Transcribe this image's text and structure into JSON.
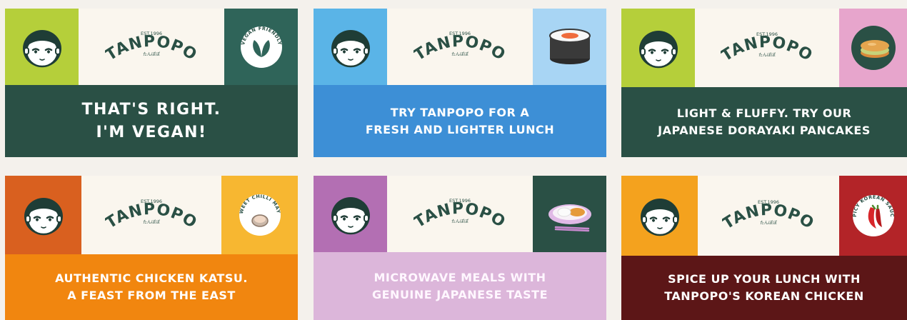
{
  "brand": {
    "name": "TANPOPO",
    "est": "EST.1996",
    "sub": "たんぽぽ"
  },
  "cards": [
    {
      "left_color": "#b5cf3a",
      "right_color": "#2f6459",
      "bottom_color": "#2a5045",
      "text_color": "#ffffff",
      "product_icon": "vegan-leaf-badge-icon",
      "badge_text": "VEGAN FRIENDLY",
      "lines": [
        "THAT'S RIGHT.",
        "I'M VEGAN!"
      ]
    },
    {
      "left_color": "#5ab4e7",
      "right_color": "#a8d5f4",
      "bottom_color": "#3d8fd6",
      "text_color": "#ffffff",
      "product_icon": "sushi-roll-icon",
      "badge_text": "",
      "lines": [
        "TRY TANPOPO FOR A",
        "FRESH AND LIGHTER LUNCH"
      ]
    },
    {
      "left_color": "#b5cf3a",
      "right_color": "#e7a5cc",
      "bottom_color": "#2a5045",
      "text_color": "#ffffff",
      "product_icon": "dorayaki-pancake-icon",
      "badge_text": "",
      "lines": [
        "LIGHT & FLUFFY. TRY OUR",
        "JAPANESE DORAYAKI PANCAKES"
      ]
    },
    {
      "left_color": "#d9601f",
      "right_color": "#f7b731",
      "bottom_color": "#f1860f",
      "text_color": "#ffffff",
      "product_icon": "sweet-chilli-mayo-icon",
      "badge_text": "SWEET CHILLI MAYO",
      "lines": [
        "AUTHENTIC CHICKEN KATSU.",
        "A FEAST FROM THE EAST"
      ]
    },
    {
      "left_color": "#b36fb3",
      "right_color": "#2a5045",
      "bottom_color": "#dcb6da",
      "text_color": "#fff7ff",
      "product_icon": "katsu-plate-chopsticks-icon",
      "badge_text": "",
      "lines": [
        "MICROWAVE MEALS WITH",
        "GENUINE JAPANESE TASTE"
      ]
    },
    {
      "left_color": "#f4a21e",
      "right_color": "#b32428",
      "bottom_color": "#5c1617",
      "text_color": "#ffffff",
      "product_icon": "chilli-pepper-icon",
      "badge_text": "SPICY KOREAN SAUCE",
      "lines": [
        "SPICE UP YOUR LUNCH WITH",
        "TANPOPO'S KOREAN CHICKEN"
      ]
    }
  ]
}
